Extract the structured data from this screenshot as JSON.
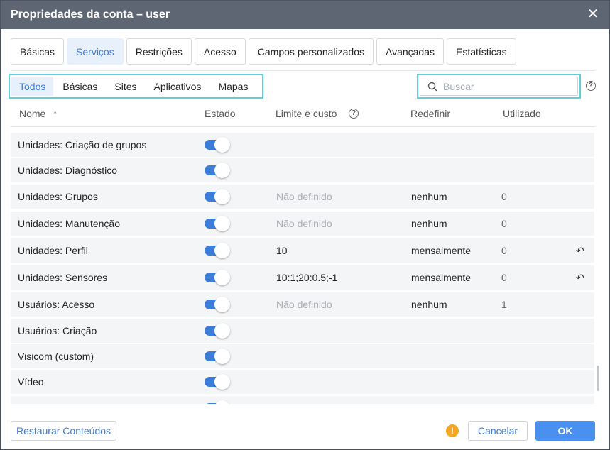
{
  "dialog": {
    "title": "Propriedades da conta – user",
    "close_glyph": "✕"
  },
  "tabs": [
    {
      "label": "Básicas",
      "active": false
    },
    {
      "label": "Serviços",
      "active": true
    },
    {
      "label": "Restrições",
      "active": false
    },
    {
      "label": "Acesso",
      "active": false
    },
    {
      "label": "Campos personalizados",
      "active": false
    },
    {
      "label": "Avançadas",
      "active": false
    },
    {
      "label": "Estatísticas",
      "active": false
    }
  ],
  "filters": [
    {
      "label": "Todos",
      "active": true
    },
    {
      "label": "Básicas",
      "active": false
    },
    {
      "label": "Sites",
      "active": false
    },
    {
      "label": "Aplicativos",
      "active": false
    },
    {
      "label": "Mapas",
      "active": false
    }
  ],
  "search": {
    "placeholder": "Buscar",
    "value": ""
  },
  "table": {
    "headers": {
      "name": "Nome",
      "state": "Estado",
      "limit": "Limite e custo",
      "reset": "Redefinir",
      "used": "Utilizado"
    },
    "sort_glyph": "↑",
    "rows": [
      {
        "name": "Unidades: Criação de grupos",
        "enabled": true,
        "limit": "",
        "limit_muted": false,
        "reset": "",
        "used": "",
        "reset_icon": false
      },
      {
        "name": "Unidades: Diagnóstico",
        "enabled": true,
        "limit": "",
        "limit_muted": false,
        "reset": "",
        "used": "",
        "reset_icon": false
      },
      {
        "name": "Unidades: Grupos",
        "enabled": true,
        "limit": "Não definido",
        "limit_muted": true,
        "reset": "nenhum",
        "used": "0",
        "reset_icon": false
      },
      {
        "name": "Unidades: Manutenção",
        "enabled": true,
        "limit": "Não definido",
        "limit_muted": true,
        "reset": "nenhum",
        "used": "0",
        "reset_icon": false
      },
      {
        "name": "Unidades: Perfil",
        "enabled": true,
        "limit": "10",
        "limit_muted": false,
        "reset": "mensalmente",
        "used": "0",
        "reset_icon": true
      },
      {
        "name": "Unidades: Sensores",
        "enabled": true,
        "limit": "10:1;20:0.5;-1",
        "limit_muted": false,
        "reset": "mensalmente",
        "used": "0",
        "reset_icon": true
      },
      {
        "name": "Usuários: Acesso",
        "enabled": true,
        "limit": "Não definido",
        "limit_muted": true,
        "reset": "nenhum",
        "used": "1",
        "reset_icon": false
      },
      {
        "name": "Usuários: Criação",
        "enabled": true,
        "limit": "",
        "limit_muted": false,
        "reset": "",
        "used": "",
        "reset_icon": false
      },
      {
        "name": "Visicom (custom)",
        "enabled": true,
        "limit": "",
        "limit_muted": false,
        "reset": "",
        "used": "",
        "reset_icon": false
      },
      {
        "name": "Vídeo",
        "enabled": true,
        "limit": "",
        "limit_muted": false,
        "reset": "",
        "used": "",
        "reset_icon": false
      },
      {
        "name": "Website (custom)",
        "enabled": true,
        "limit": "",
        "limit_muted": false,
        "reset": "",
        "used": "",
        "reset_icon": false
      }
    ]
  },
  "footer": {
    "restore_label": "Restaurar Conteúdos",
    "cancel_label": "Cancelar",
    "ok_label": "OK",
    "warning_glyph": "!"
  },
  "icons": {
    "close": "close-icon",
    "search": "search-icon",
    "help": "help-icon",
    "sort": "sort-ascending-icon",
    "reset": "undo-icon",
    "warning": "warning-icon"
  },
  "colors": {
    "accent": "#3b7dd8",
    "titlebar": "#5f6673",
    "highlight": "#5fd0d8",
    "warning": "#f5a623",
    "ok_button": "#4a90f0"
  }
}
